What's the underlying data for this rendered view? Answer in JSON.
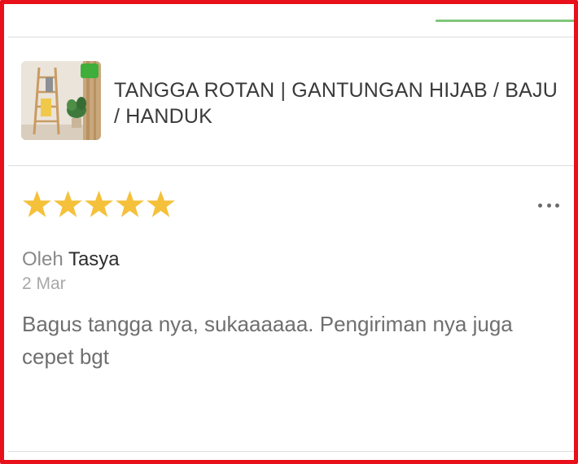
{
  "product": {
    "title": "TANGGA ROTAN | GANTUNGAN HIJAB / BAJU / HANDUK",
    "thumbnail_icon": "product-photo-ladder-rack"
  },
  "review": {
    "rating": 5,
    "rating_max": 5,
    "star_color": "#f5c13b",
    "author_prefix": "Oleh",
    "author_name": "Tasya",
    "date": "2 Mar",
    "text": "Bagus tangga nya, sukaaaaaa. Pengiriman nya juga cepet bgt"
  },
  "colors": {
    "tab_indicator": "#7fc77a",
    "frame_border": "#e8101a"
  }
}
